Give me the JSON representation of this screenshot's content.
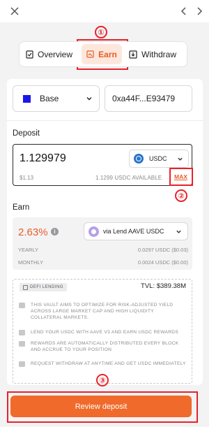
{
  "tabs": [
    {
      "label": "Overview"
    },
    {
      "label": "Earn"
    },
    {
      "label": "Withdraw"
    }
  ],
  "chain": {
    "name": "Base",
    "color": "#1a18e6"
  },
  "address": "0xa44F...E93479",
  "deposit": {
    "heading": "Deposit",
    "amount": "1.129979",
    "token": "USDC",
    "usd_value": "$1.13",
    "available": "1.1299 USDC AVAILABLE",
    "max_label": "MAX"
  },
  "earn": {
    "heading": "Earn",
    "apy": "2.63%",
    "vault": "via Lend AAVE USDC",
    "yearly_label": "YEARLY",
    "yearly_value": "0.0297 USDC ($0.03)",
    "monthly_label": "MONTHLY",
    "monthly_value": "0.0024 USDC ($0.00)"
  },
  "info": {
    "badge": "DEFI LENDING",
    "tvl": "TVL: $389.38M",
    "features": [
      "THIS VAULT AIMS TO OPTIMIZE FOR RISK-ADJUSTED YIELD ACROSS LARGE MARKET CAP AND HIGH LIQUIDITY COLLATERAL MARKETS.",
      "LEND YOUR USDC WITH AAVE V3 AND EARN USDC REWARDS",
      "REWARDS ARE AUTOMATICALLY DISTRIBUTED EVERY BLOCK AND ACCRUE TO YOUR POSITION",
      "REQUEST WITHDRAW AT ANYTIME AND GET USDC IMMEDIATELY"
    ]
  },
  "review_button": "Review deposit",
  "annotations": [
    "①",
    "②",
    "③"
  ],
  "colors": {
    "accent": "#f06a2b",
    "annotation": "#e8222a",
    "token": "#2775ca"
  }
}
